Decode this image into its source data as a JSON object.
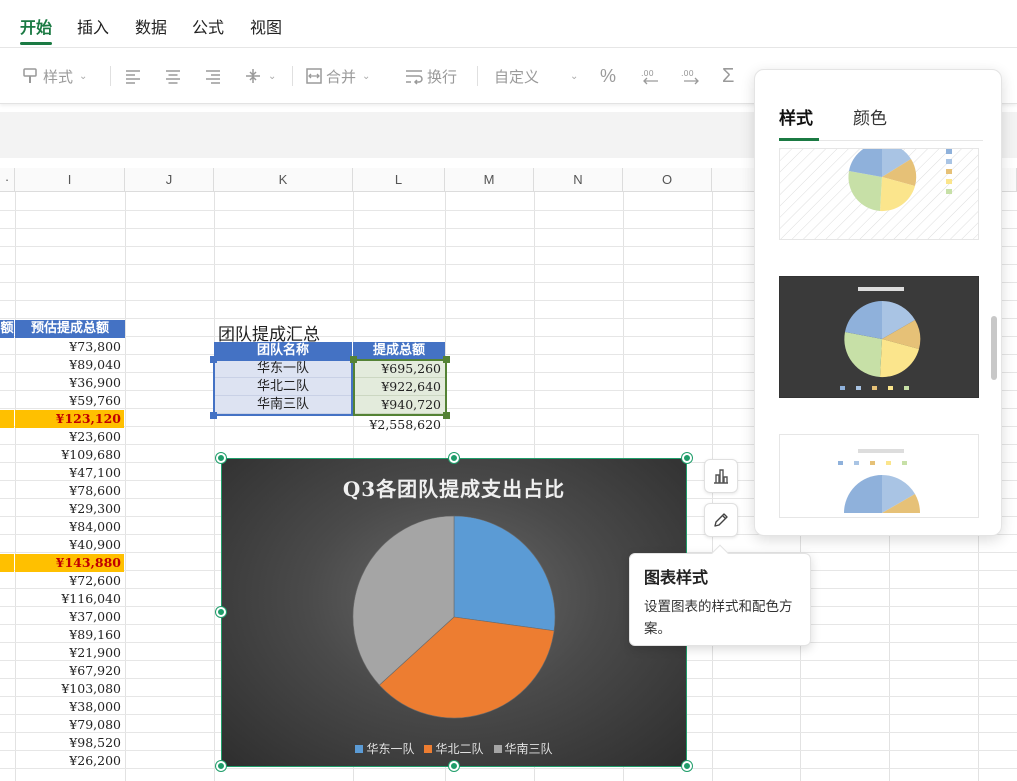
{
  "ribbon": {
    "tabs": [
      "开始",
      "插入",
      "数据",
      "公式",
      "视图"
    ],
    "active_tab": "开始",
    "toolbar": {
      "style_label": "样式",
      "merge_label": "合并",
      "wrap_label": "换行",
      "number_format": "自定义"
    }
  },
  "grid": {
    "columns": [
      "I",
      "J",
      "K",
      "L",
      "M",
      "N",
      "O"
    ],
    "i_header": "预估提成总额",
    "i_values": [
      "¥73,800",
      "¥89,040",
      "¥36,900",
      "¥59,760",
      "¥123,120",
      "¥23,600",
      "¥109,680",
      "¥47,100",
      "¥78,600",
      "¥29,300",
      "¥84,000",
      "¥40,900",
      "¥143,880",
      "¥72,600",
      "¥116,040",
      "¥37,000",
      "¥89,160",
      "¥21,900",
      "¥67,920",
      "¥103,080",
      "¥38,000",
      "¥79,080",
      "¥98,520",
      "¥26,200"
    ],
    "i_highlight_rows": [
      4,
      12
    ],
    "highlight_colors": {
      "fill": "#ffc000",
      "text": "#c00000"
    }
  },
  "summary": {
    "title": "团队提成汇总",
    "headers": [
      "团队名称",
      "提成总额"
    ],
    "rows": [
      {
        "team": "华东一队",
        "amount": "¥695,260"
      },
      {
        "team": "华北二队",
        "amount": "¥922,640"
      },
      {
        "team": "华南三队",
        "amount": "¥940,720"
      }
    ],
    "total": "¥2,558,620",
    "header_color": "#4472c4"
  },
  "chart_data": {
    "type": "pie",
    "title": "Q3各团队提成支出占比",
    "categories": [
      "华东一队",
      "华北二队",
      "华南三队"
    ],
    "values": [
      695260,
      922640,
      940720
    ],
    "colors": [
      "#5b9bd5",
      "#ed7d31",
      "#a5a5a5"
    ],
    "legend": "bottom"
  },
  "side_buttons": [
    "chart-elements-icon",
    "pencil-icon"
  ],
  "tooltip": {
    "title": "图表样式",
    "description": "设置图表的样式和配色方案。"
  },
  "style_panel": {
    "tabs": [
      "样式",
      "颜色"
    ],
    "active_tab": "样式"
  }
}
